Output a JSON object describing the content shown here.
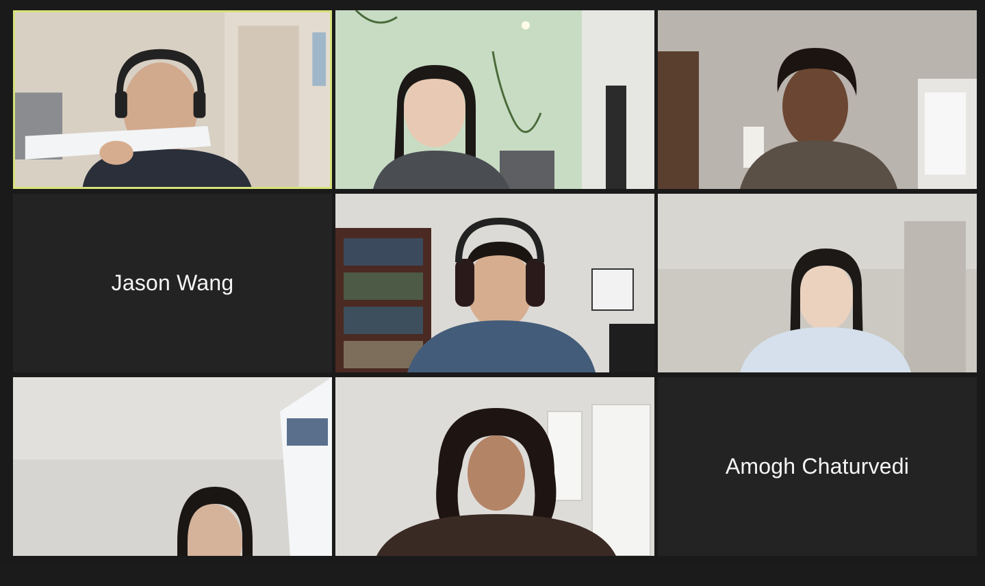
{
  "tiles": [
    {
      "id": "p1",
      "type": "video",
      "active": true
    },
    {
      "id": "p2",
      "type": "video"
    },
    {
      "id": "p3",
      "type": "video"
    },
    {
      "id": "p4",
      "type": "name",
      "name": "Jason Wang"
    },
    {
      "id": "p5",
      "type": "video"
    },
    {
      "id": "p6",
      "type": "video"
    },
    {
      "id": "p7",
      "type": "video"
    },
    {
      "id": "p8",
      "type": "video"
    },
    {
      "id": "p9",
      "type": "name",
      "name": "Amogh Chaturvedi"
    }
  ],
  "colors": {
    "background": "#1a1a1a",
    "tile_background": "#232323",
    "active_speaker_border": "#d6e27a",
    "name_text": "#f5f5f5"
  }
}
